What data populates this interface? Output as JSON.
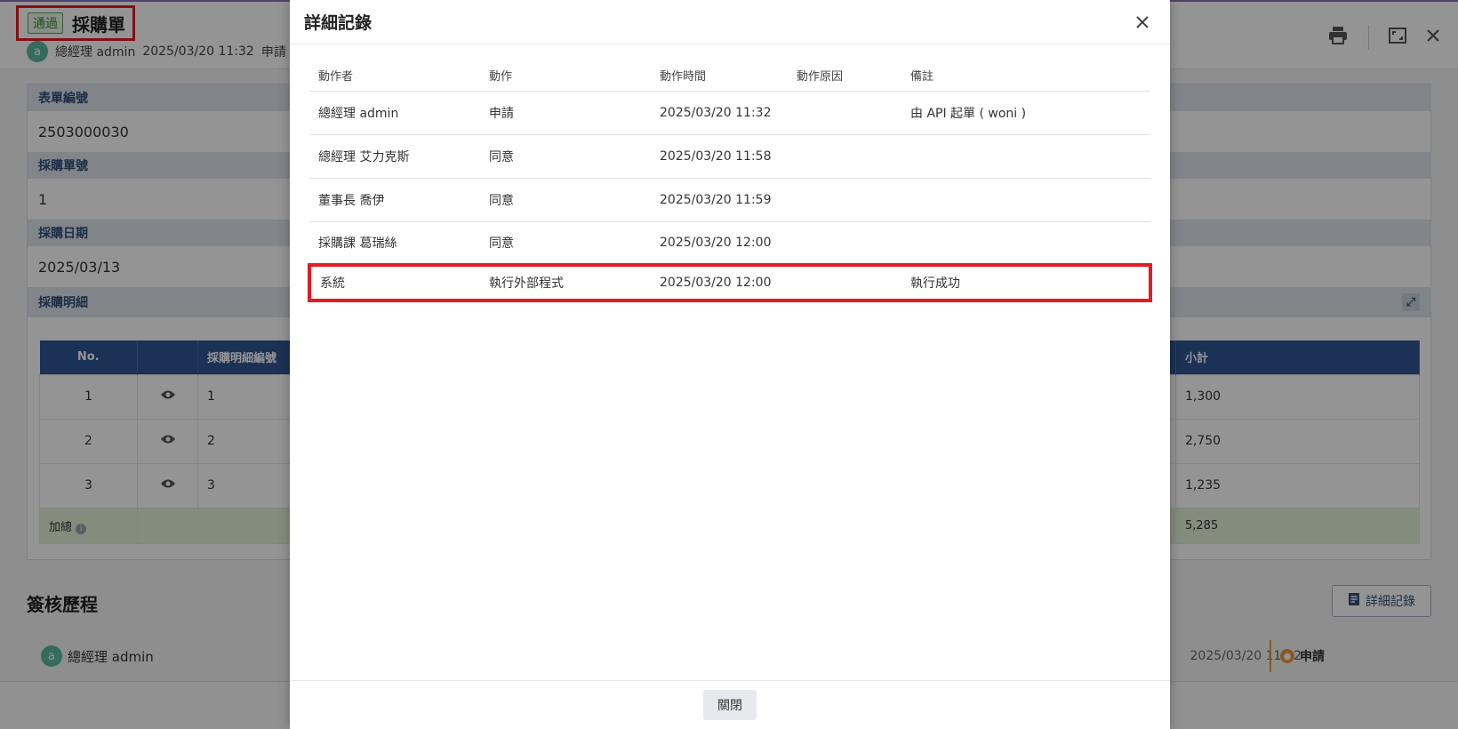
{
  "header": {
    "badge": "通過",
    "title": "採購單",
    "applicant_avatar": "a",
    "applicant": "總經理 admin",
    "applied_time": "2025/03/20 11:32",
    "applied_action": "申請"
  },
  "form": {
    "fields": [
      {
        "label": "表單編號",
        "value": "2503000030"
      },
      {
        "label": "採購單號",
        "value": "1"
      },
      {
        "label": "採購日期",
        "value": "2025/03/13"
      }
    ],
    "detail_label": "採購明細",
    "table": {
      "columns": [
        "No.",
        "",
        "採購明細編號",
        "小計"
      ],
      "rows": [
        {
          "no": "1",
          "code": "1",
          "subtotal": "1,300"
        },
        {
          "no": "2",
          "code": "2",
          "subtotal": "2,750"
        },
        {
          "no": "3",
          "code": "3",
          "subtotal": "1,235"
        }
      ],
      "sum_label": "加總",
      "sum_value": "5,285"
    }
  },
  "history": {
    "title": "簽核歷程",
    "detail_button": "詳細記錄",
    "row": {
      "avatar": "a",
      "name": "總經理 admin",
      "time": "2025/03/20 11:32",
      "status": "申請"
    }
  },
  "modal": {
    "title": "詳細記錄",
    "columns": [
      "動作者",
      "動作",
      "動作時間",
      "動作原因",
      "備註"
    ],
    "rows": [
      {
        "actor": "總經理 admin",
        "action": "申請",
        "time": "2025/03/20 11:32",
        "reason": "",
        "note": "由 API 起單 ( woni )"
      },
      {
        "actor": "總經理 艾力克斯",
        "action": "同意",
        "time": "2025/03/20 11:58",
        "reason": "",
        "note": ""
      },
      {
        "actor": "董事長 喬伊",
        "action": "同意",
        "time": "2025/03/20 11:59",
        "reason": "",
        "note": ""
      },
      {
        "actor": "採購課 葛瑞絲",
        "action": "同意",
        "time": "2025/03/20 12:00",
        "reason": "",
        "note": ""
      },
      {
        "actor": "系統",
        "action": "執行外部程式",
        "time": "2025/03/20 12:00",
        "reason": "",
        "note": "執行成功"
      }
    ],
    "close_button": "關閉"
  },
  "colors": {
    "accent_blue": "#2f5595",
    "highlight_red": "#e31b23",
    "pass_green": "#3a8a3a",
    "avatar_teal": "#5cb8a0"
  },
  "icons": [
    "print-icon",
    "fullscreen-icon",
    "close-icon",
    "eye-icon",
    "expand-icon",
    "info-icon",
    "document-icon",
    "user-status-icon"
  ]
}
